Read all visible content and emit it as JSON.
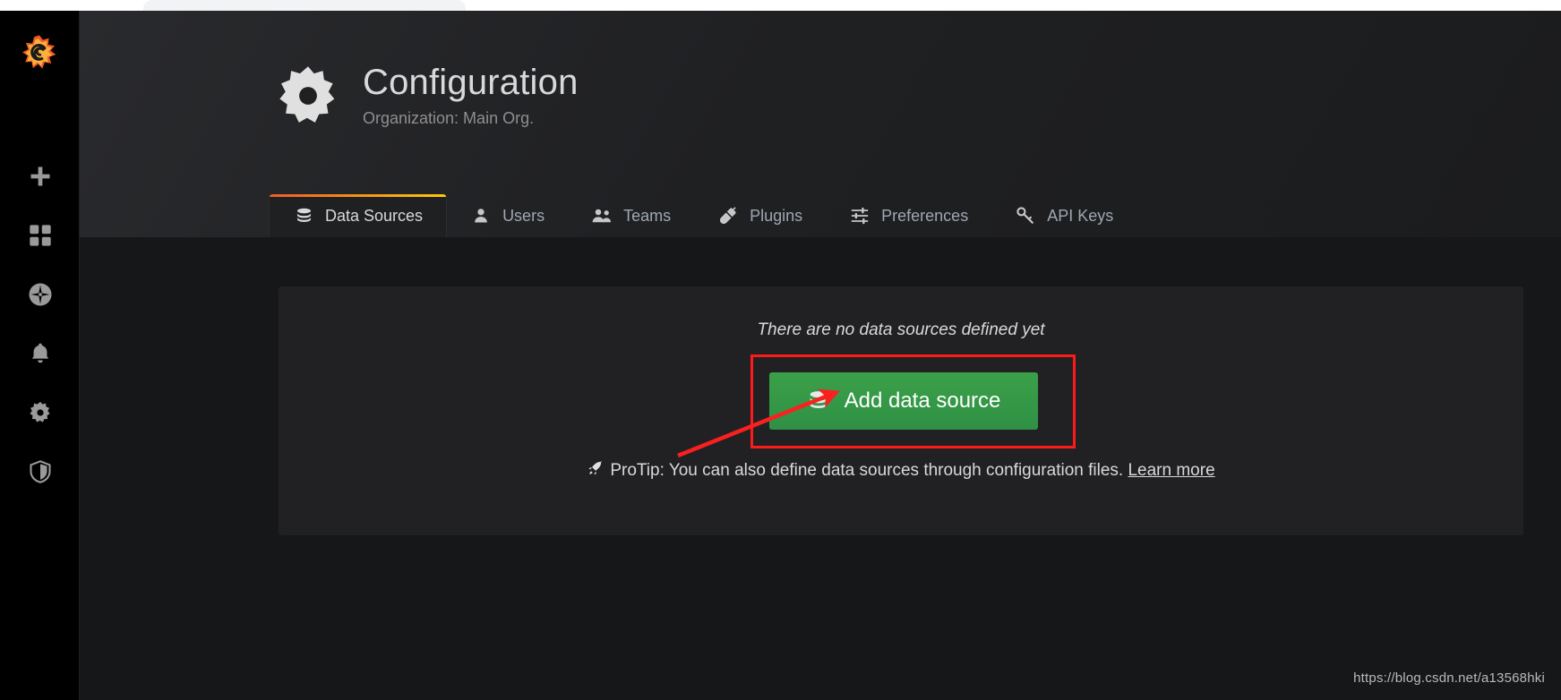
{
  "browser": {
    "tab_strip": "browser-tab-strip"
  },
  "sidebar": {
    "brand": "grafana-logo",
    "items": [
      {
        "name": "create",
        "icon": "plus-icon"
      },
      {
        "name": "dashboards",
        "icon": "dashboards-grid-icon"
      },
      {
        "name": "explore",
        "icon": "compass-icon"
      },
      {
        "name": "alerting",
        "icon": "bell-icon"
      },
      {
        "name": "configuration",
        "icon": "gear-icon"
      },
      {
        "name": "server-admin",
        "icon": "shield-icon"
      }
    ]
  },
  "header": {
    "icon": "gear-icon",
    "title": "Configuration",
    "subtitle": "Organization: Main Org."
  },
  "tabs": [
    {
      "label": "Data Sources",
      "icon": "database-icon",
      "active": true
    },
    {
      "label": "Users",
      "icon": "user-icon",
      "active": false
    },
    {
      "label": "Teams",
      "icon": "users-group-icon",
      "active": false
    },
    {
      "label": "Plugins",
      "icon": "plug-icon",
      "active": false
    },
    {
      "label": "Preferences",
      "icon": "sliders-icon",
      "active": false
    },
    {
      "label": "API Keys",
      "icon": "key-icon",
      "active": false
    }
  ],
  "main": {
    "empty_message": "There are no data sources defined yet",
    "add_button_label": "Add data source",
    "add_button_icon": "database-icon",
    "protip_icon": "rocket-icon",
    "protip_text": "ProTip: You can also define data sources through configuration files.",
    "protip_link_label": "Learn more"
  },
  "annotations": {
    "highlight_color": "#ff1a1a",
    "arrow_color": "#fb2020"
  },
  "watermark": "https://blog.csdn.net/a13568hki",
  "colors": {
    "accent_start": "#f05a28",
    "accent_end": "#fbca0a",
    "button_green": "#2f9044",
    "page_bg": "#161719",
    "panel_bg": "#212124"
  }
}
